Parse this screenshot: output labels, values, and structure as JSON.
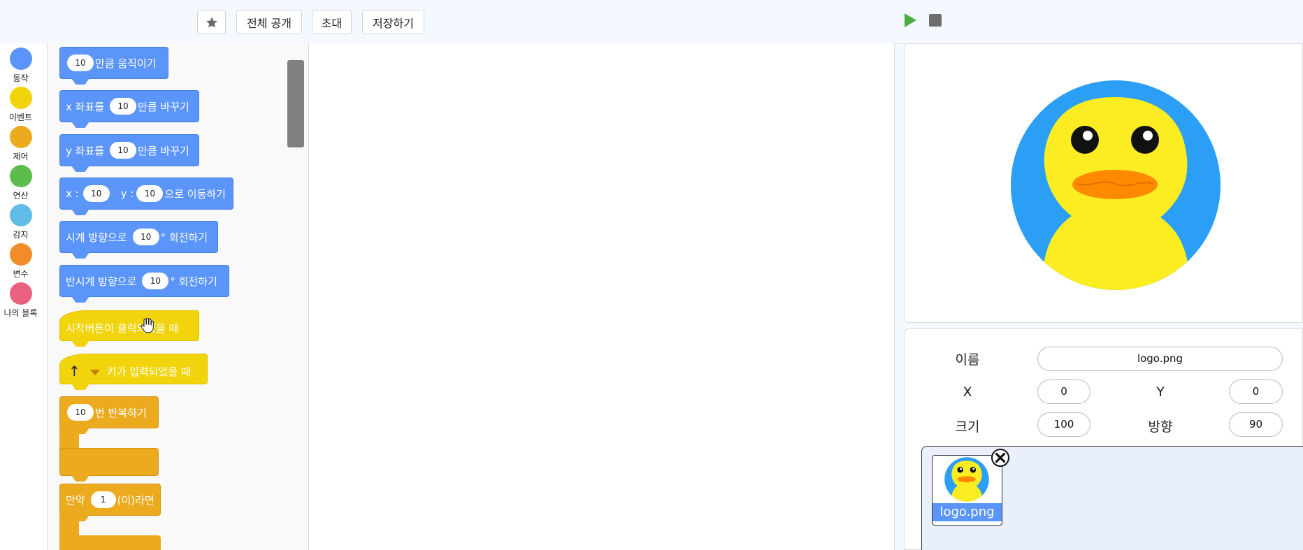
{
  "toolbar": {
    "favorite_icon": "star-icon",
    "share_all_label": "전체 공개",
    "invite_label": "초대",
    "save_label": "저장하기",
    "run_icon": "play-icon",
    "stop_icon": "stop-icon"
  },
  "categories": [
    {
      "label": "동작",
      "color": "#5b95f9"
    },
    {
      "label": "이벤트",
      "color": "#f2d40c"
    },
    {
      "label": "제어",
      "color": "#ecaa1f"
    },
    {
      "label": "연산",
      "color": "#5cbd4c"
    },
    {
      "label": "감지",
      "color": "#5fbde8"
    },
    {
      "label": "변수",
      "color": "#f28c28"
    },
    {
      "label": "나의 블록",
      "color": "#e8627f"
    }
  ],
  "blocks": {
    "move": {
      "value": "10",
      "text": "만큼 움직이기"
    },
    "change_x": {
      "prefix": "x 좌표를",
      "value": "10",
      "suffix": "만큼 바꾸기"
    },
    "change_y": {
      "prefix": "y 좌표를",
      "value": "10",
      "suffix": "만큼 바꾸기"
    },
    "goto": {
      "x_label": "x :",
      "x_value": "10",
      "y_label": "y :",
      "y_value": "10",
      "suffix": "으로 이동하기"
    },
    "turn_cw": {
      "prefix": "시계 방향으로",
      "value": "10",
      "suffix": "° 회전하기"
    },
    "turn_ccw": {
      "prefix": "반시계 방향으로",
      "value": "10",
      "suffix": "° 회전하기"
    },
    "when_start": {
      "text": "시작버튼이 클릭되었을 때"
    },
    "when_key": {
      "key": "↑",
      "text": "키가 입력되었을 때"
    },
    "repeat": {
      "value": "10",
      "text": "번 반복하기"
    },
    "if_block": {
      "prefix": "만약",
      "value": "1",
      "suffix": "(이)라면"
    }
  },
  "sprite": {
    "name_label": "이름",
    "name_value": "logo.png",
    "x_label": "X",
    "x_value": "0",
    "y_label": "Y",
    "y_value": "0",
    "size_label": "크기",
    "size_value": "100",
    "direction_label": "방향",
    "direction_value": "90"
  },
  "sprite_list": [
    {
      "name": "logo.png",
      "delete_icon": "close-circle-icon"
    }
  ],
  "colors": {
    "duck_background": "#2b9ef5",
    "duck_body": "#fced23",
    "duck_beak": "#ff8a00",
    "run_green": "#4cae3e"
  }
}
